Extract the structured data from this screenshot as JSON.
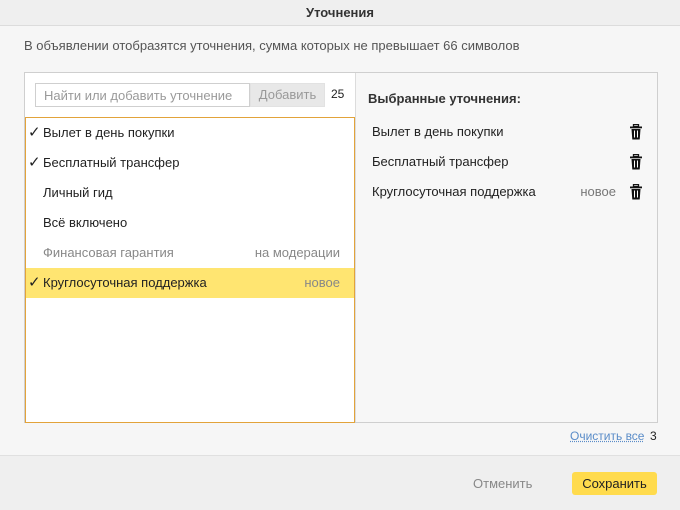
{
  "dialog": {
    "title": "Уточнения"
  },
  "description": "В объявлении отобразятся уточнения, сумма которых не превышает 66 символов",
  "search": {
    "placeholder": "Найти или добавить уточнение",
    "value": "",
    "add_label": "Добавить",
    "char_counter": "25"
  },
  "options": [
    {
      "label": "Вылет в день покупки",
      "checked": true,
      "status": "",
      "highlighted": false,
      "moderation": false
    },
    {
      "label": "Бесплатный трансфер",
      "checked": true,
      "status": "",
      "highlighted": false,
      "moderation": false
    },
    {
      "label": "Личный гид",
      "checked": false,
      "status": "",
      "highlighted": false,
      "moderation": false
    },
    {
      "label": "Всё включено",
      "checked": false,
      "status": "",
      "highlighted": false,
      "moderation": false
    },
    {
      "label": "Финансовая гарантия",
      "checked": false,
      "status": "на модерации",
      "highlighted": false,
      "moderation": true
    },
    {
      "label": "Круглосуточная поддержка",
      "checked": true,
      "status": "новое",
      "highlighted": true,
      "moderation": false
    }
  ],
  "selected": {
    "title": "Выбранные уточнения:",
    "items": [
      {
        "label": "Вылет в день покупки",
        "status": ""
      },
      {
        "label": "Бесплатный трансфер",
        "status": ""
      },
      {
        "label": "Круглосуточная поддержка",
        "status": "новое"
      }
    ]
  },
  "footer": {
    "clear_all_label": "Очистить все",
    "selected_count": "3"
  },
  "actions": {
    "cancel_label": "Отменить",
    "save_label": "Сохранить"
  },
  "icons": {
    "check": "checkmark-icon",
    "delete": "trash-icon"
  },
  "colors": {
    "highlight": "#ffe571",
    "list_border": "#e2a33a",
    "primary_button": "#ffdb4d",
    "link": "#5a8cc8"
  }
}
